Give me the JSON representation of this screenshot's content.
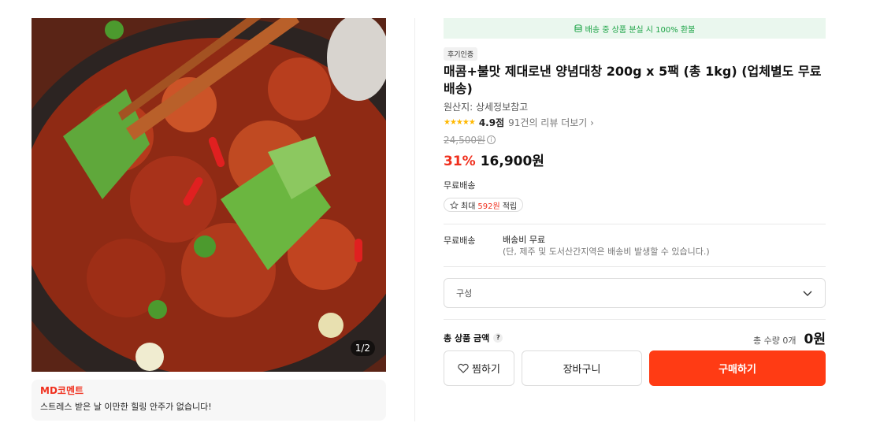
{
  "gallery": {
    "image_alt": "양념대창 볶음 이미지",
    "counter": "1/2"
  },
  "md_comment": {
    "title": "MD코멘트",
    "text": "스트레스 받은 날 이만한 힐링 안주가 없습니다!"
  },
  "banner": {
    "icon": "coin-stack-icon",
    "text": "배송 중 상품 분실 시 100% 환불"
  },
  "product": {
    "badge": "후기인증",
    "title": "매콤+불맛 제대로낸 양념대창 200g x 5팩 (총 1kg) (업체별도 무료배송)",
    "origin": "원산지: 상세정보참고",
    "stars": "★★★★★",
    "rating": "4.9점",
    "reviews_link": "91건의 리뷰 더보기",
    "original_price": "24,500원",
    "discount": "31%",
    "price": "16,900원"
  },
  "shipping": {
    "label": "무료배송",
    "points_prefix": "최대",
    "points_amount": "592원",
    "points_suffix": "적립",
    "detail_label": "무료배송",
    "detail_value": "배송비 무료",
    "detail_note": "(단, 제주 및 도서산간지역은 배송비 발생할 수 있습니다.)"
  },
  "option": {
    "placeholder": "구성"
  },
  "total": {
    "label": "총 상품 금액",
    "help": "?",
    "quantity": "총 수량 0개",
    "amount": "0원"
  },
  "buttons": {
    "wish": "찜하기",
    "cart": "장바구니",
    "buy": "구매하기"
  },
  "colors": {
    "accent": "#ff3b14",
    "discount": "#f0301e",
    "banner_text": "#1ba345",
    "banner_bg": "#eaf7ee",
    "star": "#ffb800"
  }
}
